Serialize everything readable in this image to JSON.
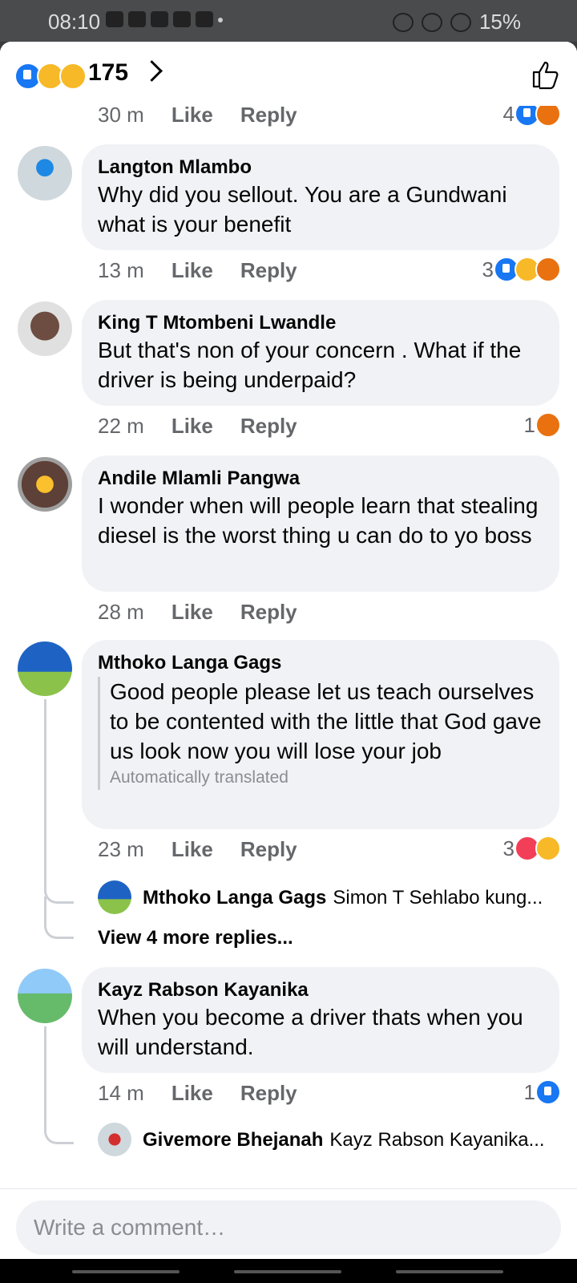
{
  "status_bar": {
    "time": "08:10",
    "battery": "15%"
  },
  "header": {
    "reaction_count": "175"
  },
  "top_meta": {
    "time": "30 m",
    "like": "Like",
    "reply": "Reply",
    "react_count": "4"
  },
  "comments": [
    {
      "name": "Langton Mlambo",
      "text": "Why did you sellout. You are a Gundwani what is your benefit",
      "time": "13 m",
      "like": "Like",
      "reply": "Reply",
      "react_count": "3"
    },
    {
      "name": "King T Mtombeni Lwandle",
      "text": "But that's non of your concern . What if the driver is being underpaid?",
      "time": "22 m",
      "like": "Like",
      "reply": "Reply",
      "react_count": "1"
    },
    {
      "name": "Andile Mlamli Pangwa",
      "text": "I wonder when will people learn that stealing diesel is the worst thing u can do to yo boss",
      "time": "28 m",
      "like": "Like",
      "reply": "Reply"
    },
    {
      "name": "Mthoko Langa Gags",
      "text": "Good people please let us teach ourselves to be contented with the little that God gave us look now you will lose your job",
      "translated_note": "Automatically translated",
      "time": "23 m",
      "like": "Like",
      "reply": "Reply",
      "react_count": "3",
      "reply_preview": {
        "name": "Mthoko Langa Gags",
        "text": "Simon T Sehlabo kung..."
      },
      "view_more": "View 4 more replies..."
    },
    {
      "name": "Kayz Rabson Kayanika",
      "text": "When you become a driver thats when you will understand.",
      "time": "14 m",
      "like": "Like",
      "reply": "Reply",
      "react_count": "1",
      "reply_preview": {
        "name": "Givemore Bhejanah",
        "text": "Kayz Rabson Kayanika..."
      }
    }
  ],
  "composer": {
    "placeholder": "Write a comment…"
  }
}
